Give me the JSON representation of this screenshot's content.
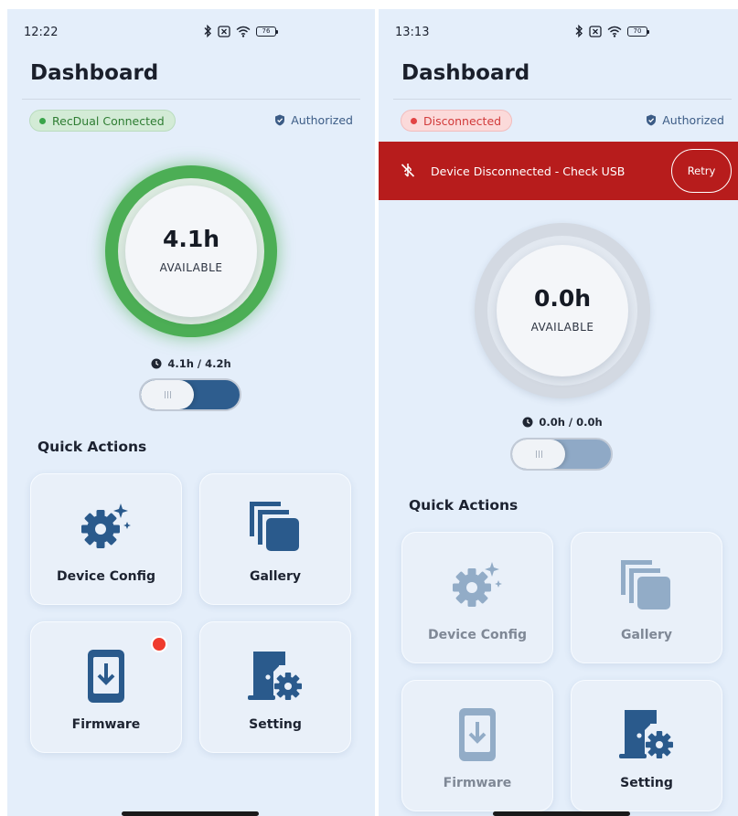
{
  "screens": [
    {
      "status": {
        "time": "12:22",
        "battery": "76"
      },
      "title": "Dashboard",
      "connection": {
        "label": "RecDual Connected",
        "state": "connected",
        "color": "#3aa54a"
      },
      "auth_label": "Authorized",
      "gauge": {
        "value": "4.1h",
        "unit": "AVAILABLE",
        "fill_fraction": 0.976,
        "ring_color": "#3aa54a"
      },
      "usage": "4.1h / 4.2h",
      "toggle_on": true,
      "section_title": "Quick Actions",
      "actions": [
        {
          "label": "Device Config",
          "icon": "gear-sparkle-icon",
          "enabled": true
        },
        {
          "label": "Gallery",
          "icon": "gallery-icon",
          "enabled": true
        },
        {
          "label": "Firmware",
          "icon": "phone-download-icon",
          "enabled": true,
          "badge": true
        },
        {
          "label": "Setting",
          "icon": "door-gear-icon",
          "enabled": true
        }
      ]
    },
    {
      "status": {
        "time": "13:13",
        "battery": "70"
      },
      "title": "Dashboard",
      "connection": {
        "label": "Disconnected",
        "state": "disconnected",
        "color": "#e24444"
      },
      "auth_label": "Authorized",
      "alert": {
        "message": "Device Disconnected - Check USB",
        "action": "Retry",
        "color": "#b71c1c"
      },
      "gauge": {
        "value": "0.0h",
        "unit": "AVAILABLE",
        "fill_fraction": 0,
        "ring_color": "#d2d8e1"
      },
      "usage": "0.0h / 0.0h",
      "toggle_on": true,
      "section_title": "Quick Actions",
      "actions": [
        {
          "label": "Device Config",
          "icon": "gear-sparkle-icon",
          "enabled": false
        },
        {
          "label": "Gallery",
          "icon": "gallery-icon",
          "enabled": false
        },
        {
          "label": "Firmware",
          "icon": "phone-download-icon",
          "enabled": false
        },
        {
          "label": "Setting",
          "icon": "door-gear-icon",
          "enabled": true
        }
      ]
    }
  ],
  "colors": {
    "accent": "#2f5d8c",
    "background": "#e4eefa"
  }
}
